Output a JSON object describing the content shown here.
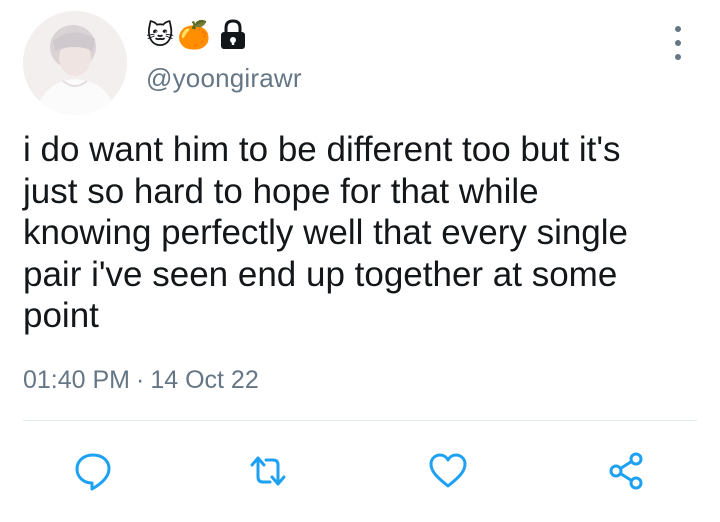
{
  "tweet": {
    "display_name_emojis": [
      "🐱",
      "🍊"
    ],
    "handle": "@yoongirawr",
    "text": "i do want him to be different too but it's\njust so hard to hope for that while\nknowing perfectly well that every single\npair i've seen end up together at some\npoint",
    "time": "01:40 PM",
    "separator": "·",
    "date": "14 Oct 22"
  },
  "icons": {
    "protected": "lock-icon",
    "more": "more-vertical-icon",
    "reply": "reply-icon",
    "retweet": "retweet-icon",
    "like": "heart-icon",
    "share": "share-icon"
  },
  "colors": {
    "text": "#14171a",
    "secondary": "#657786",
    "action_blue": "#1da1f2",
    "divider": "#e1e8ed"
  }
}
